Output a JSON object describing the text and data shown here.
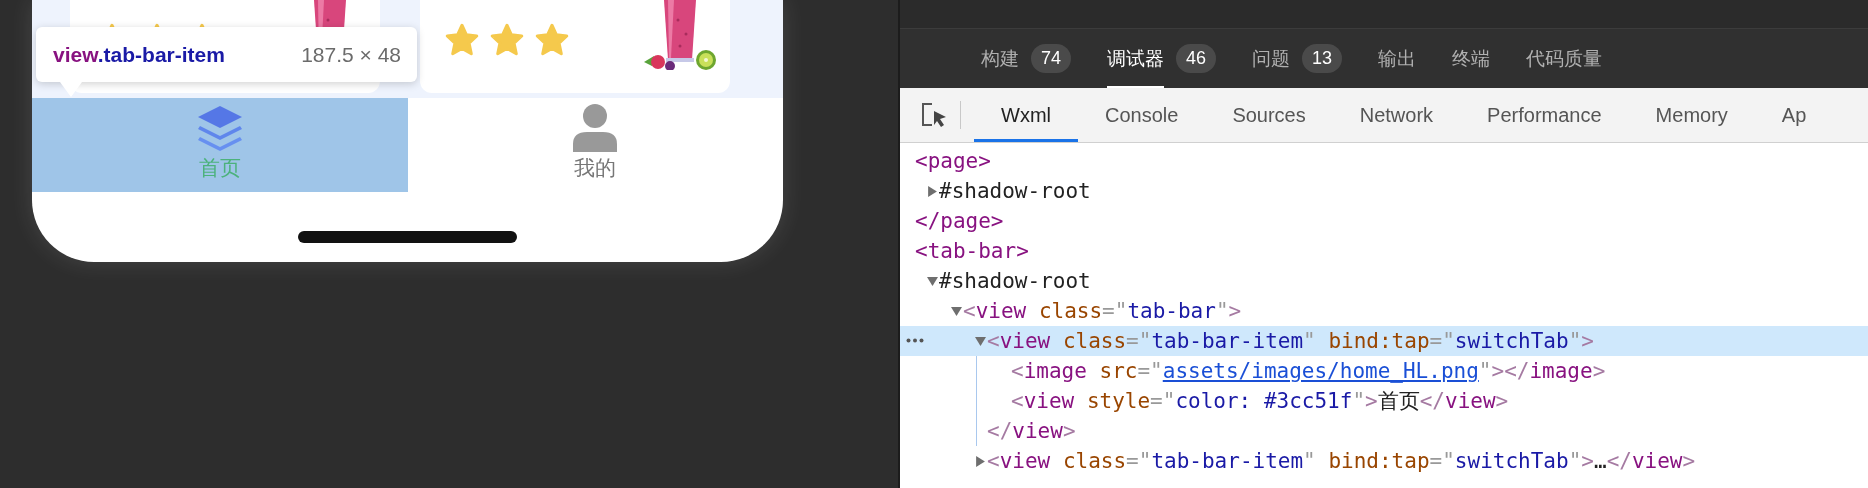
{
  "simulator": {
    "cards": [
      {
        "stars": 3
      },
      {
        "stars": 3
      }
    ],
    "inspector_tooltip": {
      "tag": "view",
      "class_name": ".tab-bar-item",
      "size": "187.5 × 48"
    },
    "tab_bar": [
      {
        "kind": "home",
        "label": "首页",
        "selected": true,
        "highlighted": true
      },
      {
        "kind": "profile",
        "label": "我的",
        "selected": false,
        "highlighted": false
      }
    ]
  },
  "devtools": {
    "panel_tabs": [
      {
        "label": "构建",
        "count": "74",
        "selected": false
      },
      {
        "label": "调试器",
        "count": "46",
        "selected": true
      },
      {
        "label": "问题",
        "count": "13",
        "selected": false
      },
      {
        "label": "输出",
        "selected": false
      },
      {
        "label": "终端",
        "selected": false
      },
      {
        "label": "代码质量",
        "selected": false
      }
    ],
    "tool_tabs": [
      {
        "label": "Wxml",
        "selected": true
      },
      {
        "label": "Console",
        "selected": false
      },
      {
        "label": "Sources",
        "selected": false
      },
      {
        "label": "Network",
        "selected": false
      },
      {
        "label": "Performance",
        "selected": false
      },
      {
        "label": "Memory",
        "selected": false
      },
      {
        "label": "Ap",
        "selected": false
      }
    ],
    "tree": [
      {
        "kind": "plain",
        "selected": false,
        "segments": [
          {
            "kind": "tag",
            "text": "<page>"
          }
        ],
        "children": [
          {
            "kind": "branch",
            "expanded": false,
            "selected": false,
            "segments": [
              {
                "kind": "text",
                "text": "#shadow-root"
              }
            ]
          }
        ],
        "closing": [
          {
            "kind": "tag",
            "text": "</page>"
          }
        ]
      },
      {
        "kind": "plain",
        "selected": false,
        "segments": [
          {
            "kind": "tag",
            "text": "<tab-bar>"
          }
        ],
        "children": [
          {
            "kind": "branch",
            "expanded": true,
            "selected": false,
            "segments": [
              {
                "kind": "text",
                "text": "#shadow-root"
              }
            ],
            "children": [
              {
                "kind": "branch",
                "expanded": true,
                "selected": false,
                "segments": [
                  {
                    "kind": "bracket",
                    "text": "<"
                  },
                  {
                    "kind": "tag",
                    "text": "view"
                  },
                  {
                    "kind": "attr",
                    "text": " class"
                  },
                  {
                    "kind": "punct",
                    "text": "=\""
                  },
                  {
                    "kind": "value",
                    "text": "tab-bar"
                  },
                  {
                    "kind": "punct",
                    "text": "\""
                  },
                  {
                    "kind": "bracket",
                    "text": ">"
                  }
                ],
                "children": [
                  {
                    "kind": "branch",
                    "expanded": true,
                    "selected": true,
                    "segments": [
                      {
                        "kind": "bracket",
                        "text": "<"
                      },
                      {
                        "kind": "tag",
                        "text": "view"
                      },
                      {
                        "kind": "attr",
                        "text": " class"
                      },
                      {
                        "kind": "punct",
                        "text": "=\""
                      },
                      {
                        "kind": "value",
                        "text": "tab-bar-item"
                      },
                      {
                        "kind": "punct",
                        "text": "\""
                      },
                      {
                        "kind": "attr",
                        "text": " bind:tap"
                      },
                      {
                        "kind": "punct",
                        "text": "=\""
                      },
                      {
                        "kind": "value",
                        "text": "switchTab"
                      },
                      {
                        "kind": "punct",
                        "text": "\""
                      },
                      {
                        "kind": "bracket",
                        "text": ">"
                      }
                    ],
                    "children": [
                      {
                        "kind": "leaf",
                        "selected": false,
                        "segments": [
                          {
                            "kind": "bracket",
                            "text": "<"
                          },
                          {
                            "kind": "tag",
                            "text": "image"
                          },
                          {
                            "kind": "attr",
                            "text": " src"
                          },
                          {
                            "kind": "punct",
                            "text": "=\""
                          },
                          {
                            "kind": "link",
                            "text": "assets/images/home_HL.png"
                          },
                          {
                            "kind": "punct",
                            "text": "\""
                          },
                          {
                            "kind": "bracket",
                            "text": "></"
                          },
                          {
                            "kind": "tag",
                            "text": "image"
                          },
                          {
                            "kind": "bracket",
                            "text": ">"
                          }
                        ]
                      },
                      {
                        "kind": "leaf",
                        "selected": false,
                        "segments": [
                          {
                            "kind": "bracket",
                            "text": "<"
                          },
                          {
                            "kind": "tag",
                            "text": "view"
                          },
                          {
                            "kind": "attr",
                            "text": " style"
                          },
                          {
                            "kind": "punct",
                            "text": "=\""
                          },
                          {
                            "kind": "value",
                            "text": "color: #3cc51f"
                          },
                          {
                            "kind": "punct",
                            "text": "\""
                          },
                          {
                            "kind": "bracket",
                            "text": ">"
                          },
                          {
                            "kind": "text",
                            "text": "首页"
                          },
                          {
                            "kind": "bracket",
                            "text": "</"
                          },
                          {
                            "kind": "tag",
                            "text": "view"
                          },
                          {
                            "kind": "bracket",
                            "text": ">"
                          }
                        ]
                      }
                    ],
                    "closing": [
                      {
                        "kind": "bracket",
                        "text": "</"
                      },
                      {
                        "kind": "tag",
                        "text": "view"
                      },
                      {
                        "kind": "bracket",
                        "text": ">"
                      }
                    ]
                  },
                  {
                    "kind": "branch",
                    "expanded": false,
                    "selected": false,
                    "segments": [
                      {
                        "kind": "bracket",
                        "text": "<"
                      },
                      {
                        "kind": "tag",
                        "text": "view"
                      },
                      {
                        "kind": "attr",
                        "text": " class"
                      },
                      {
                        "kind": "punct",
                        "text": "=\""
                      },
                      {
                        "kind": "value",
                        "text": "tab-bar-item"
                      },
                      {
                        "kind": "punct",
                        "text": "\""
                      },
                      {
                        "kind": "attr",
                        "text": " bind:tap"
                      },
                      {
                        "kind": "punct",
                        "text": "=\""
                      },
                      {
                        "kind": "value",
                        "text": "switchTab"
                      },
                      {
                        "kind": "punct",
                        "text": "\""
                      },
                      {
                        "kind": "bracket",
                        "text": ">"
                      },
                      {
                        "kind": "text",
                        "text": "…"
                      },
                      {
                        "kind": "bracket",
                        "text": "</"
                      },
                      {
                        "kind": "tag",
                        "text": "view"
                      },
                      {
                        "kind": "bracket",
                        "text": ">"
                      }
                    ]
                  }
                ]
              }
            ]
          }
        ]
      }
    ]
  }
}
